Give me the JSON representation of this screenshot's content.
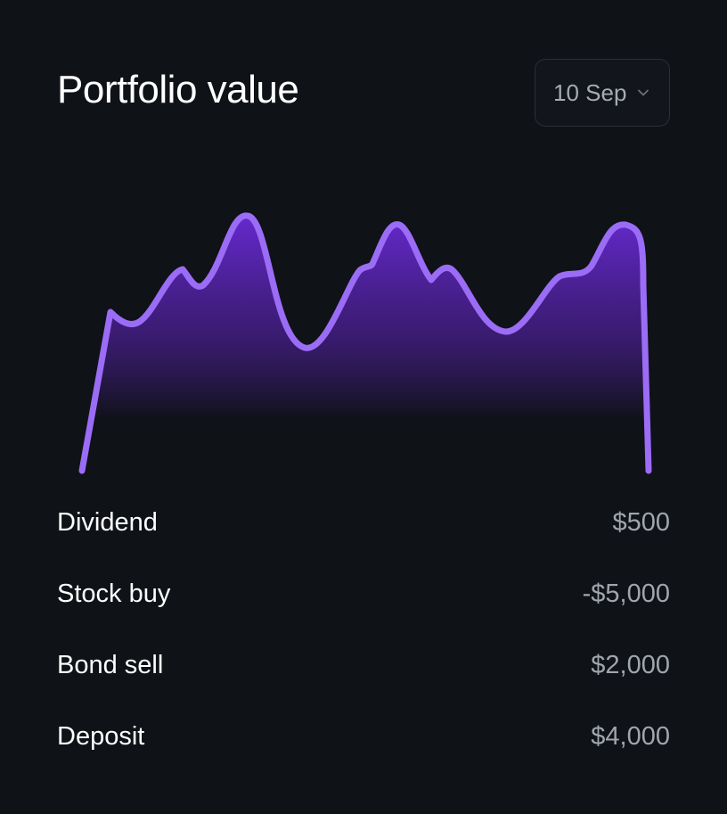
{
  "header": {
    "title": "Portfolio value",
    "date_selector": {
      "selected": "10 Sep",
      "icon": "chevron-down-icon"
    }
  },
  "chart_data": {
    "type": "area",
    "x": [
      0,
      1,
      2,
      3,
      4,
      5,
      6,
      7,
      8,
      9,
      10,
      11,
      12,
      13,
      14,
      15,
      16,
      17,
      18,
      19,
      20
    ],
    "values": [
      0,
      62,
      58,
      74,
      70,
      90,
      46,
      68,
      88,
      72,
      74,
      56,
      66,
      72,
      86,
      0
    ],
    "title": "",
    "xlabel": "",
    "ylabel": "",
    "grid": false,
    "colors": {
      "line": "#9b6cf6",
      "fill_top": "#6a2ad8",
      "fill_bottom": "#0f1217"
    }
  },
  "transactions": [
    {
      "label": "Dividend",
      "amount": "$500"
    },
    {
      "label": "Stock buy",
      "amount": "-$5,000"
    },
    {
      "label": "Bond sell",
      "amount": "$2,000"
    },
    {
      "label": "Deposit",
      "amount": "$4,000"
    }
  ]
}
